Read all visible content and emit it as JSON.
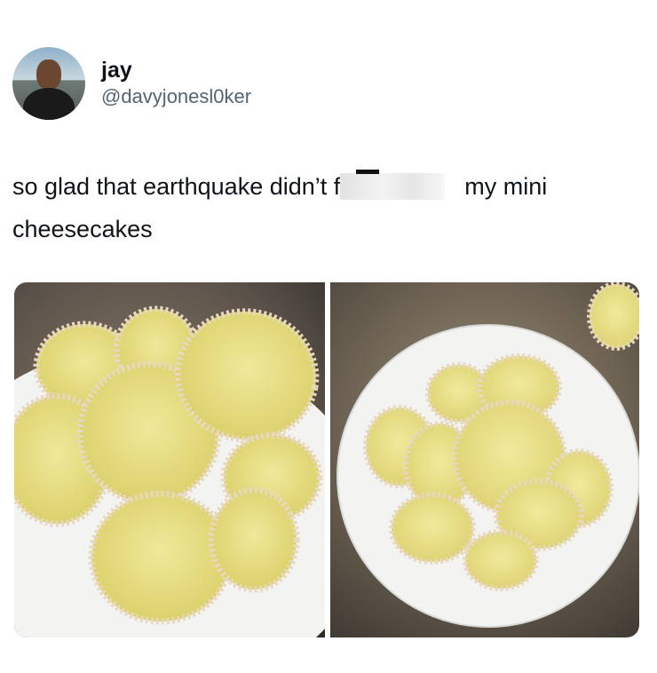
{
  "tweet": {
    "author": {
      "display_name": "jay",
      "handle": "@davyjonesl0ker",
      "avatar_icon": "avatar-photo"
    },
    "text_before_censor": "so glad that earthquake didn’t f",
    "text_after_censor": "my mini cheesecakes"
  },
  "colors": {
    "text": "#0f1419",
    "handle": "#536471",
    "cheesecake": "#e9e07a",
    "liner": "#e8d8c0",
    "plate": "#f3f3f1"
  }
}
